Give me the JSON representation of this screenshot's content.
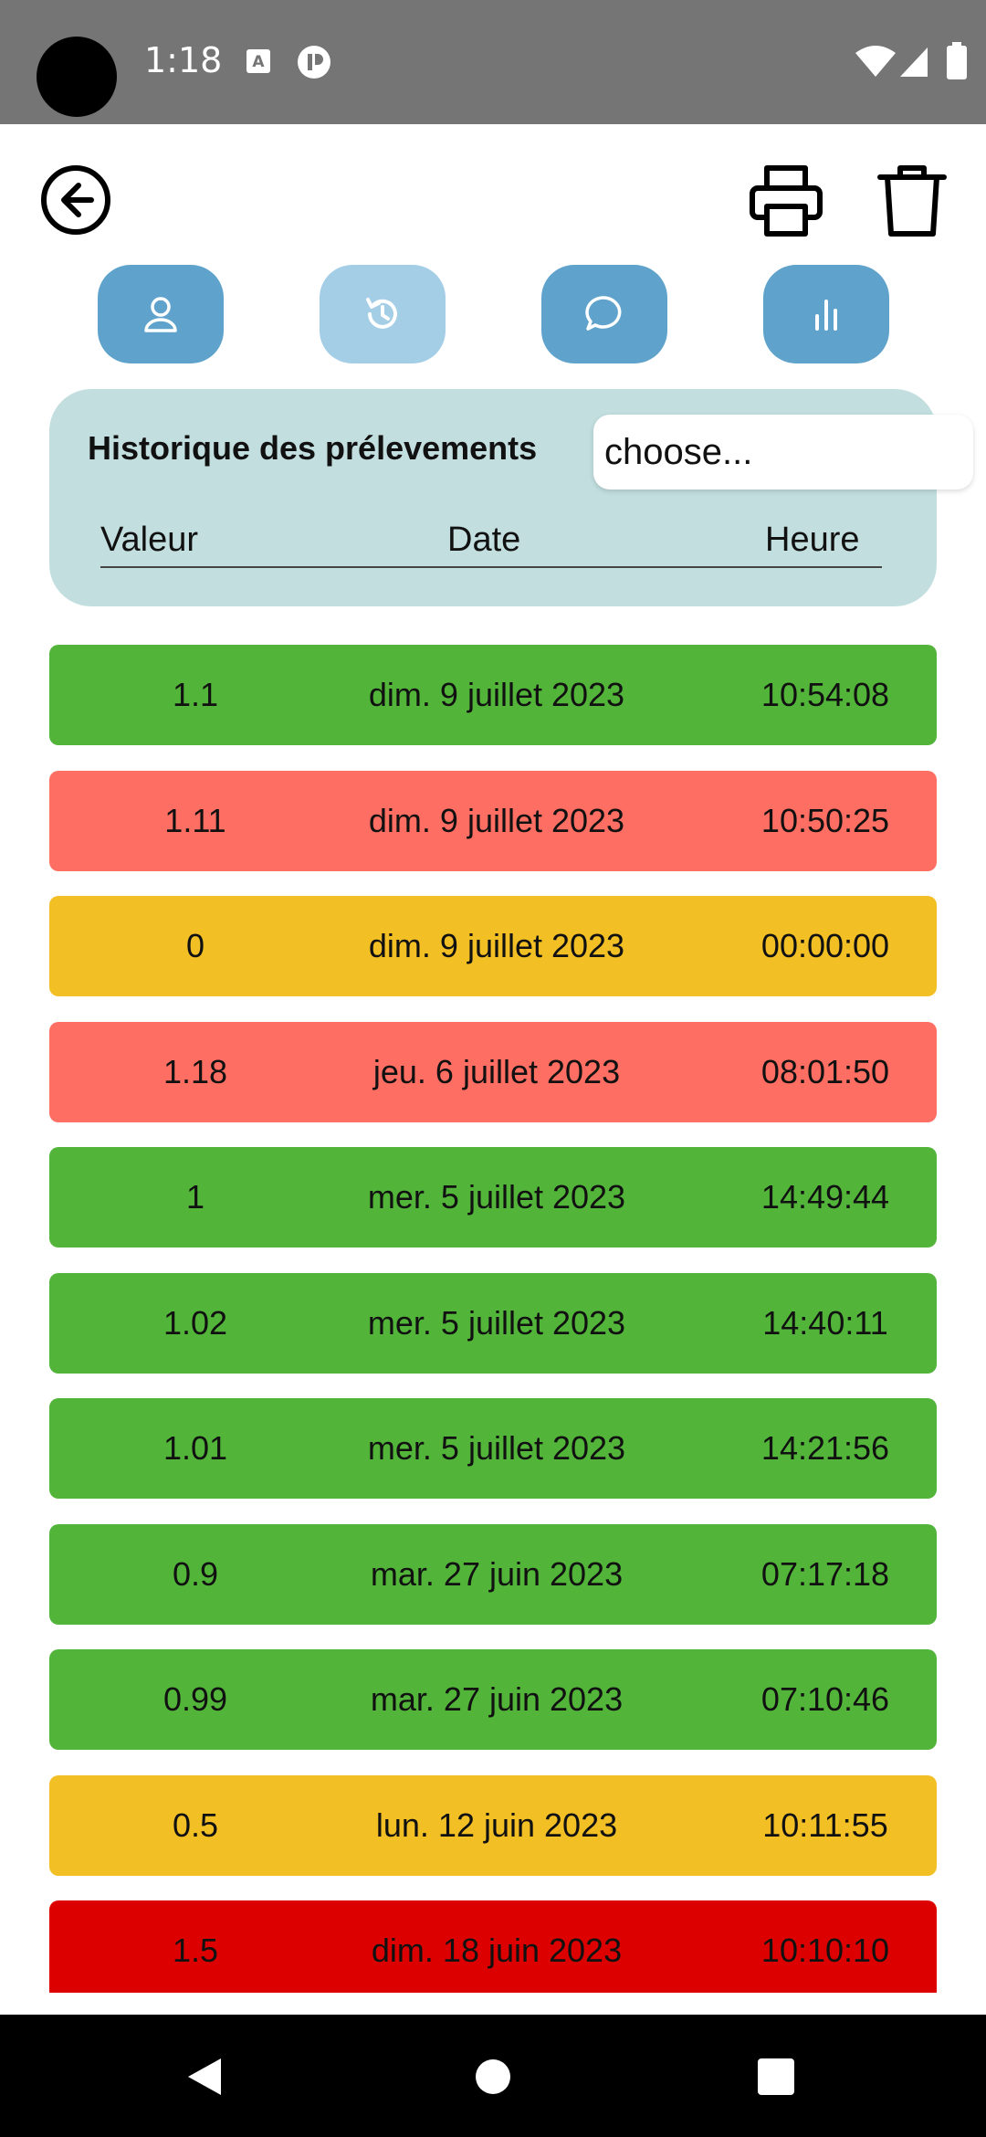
{
  "status_bar": {
    "time": "1:18"
  },
  "icons": {
    "back": "arrow-left-circle-icon",
    "print": "printer-icon",
    "trash": "trash-icon",
    "tabs": [
      "user-icon",
      "history-icon",
      "chat-icon",
      "bar-chart-icon"
    ]
  },
  "header": {
    "title": "Historique des prélevements",
    "select_value": "choose...",
    "columns": {
      "value": "Valeur",
      "date": "Date",
      "time": "Heure"
    }
  },
  "colors": {
    "green": "#52b53a",
    "salmon": "#fe6e62",
    "amber": "#f2bf25",
    "red": "#dc0000",
    "tab": "#5fa3cc",
    "tab_active": "#a4cde6",
    "card": "#c2dedf"
  },
  "rows": [
    {
      "value": "1.1",
      "date": "dim. 9 juillet 2023",
      "time": "10:54:08",
      "color": "#52b53a"
    },
    {
      "value": "1.11",
      "date": "dim. 9 juillet 2023",
      "time": "10:50:25",
      "color": "#fe6e62"
    },
    {
      "value": "0",
      "date": "dim. 9 juillet 2023",
      "time": "00:00:00",
      "color": "#f2bf25"
    },
    {
      "value": "1.18",
      "date": "jeu. 6 juillet 2023",
      "time": "08:01:50",
      "color": "#fe6e62"
    },
    {
      "value": "1",
      "date": "mer. 5 juillet 2023",
      "time": "14:49:44",
      "color": "#52b53a"
    },
    {
      "value": "1.02",
      "date": "mer. 5 juillet 2023",
      "time": "14:40:11",
      "color": "#52b53a"
    },
    {
      "value": "1.01",
      "date": "mer. 5 juillet 2023",
      "time": "14:21:56",
      "color": "#52b53a"
    },
    {
      "value": "0.9",
      "date": "mar. 27 juin 2023",
      "time": "07:17:18",
      "color": "#52b53a"
    },
    {
      "value": "0.99",
      "date": "mar. 27 juin 2023",
      "time": "07:10:46",
      "color": "#52b53a"
    },
    {
      "value": "0.5",
      "date": "lun. 12 juin 2023",
      "time": "10:11:55",
      "color": "#f2bf25"
    },
    {
      "value": "1.5",
      "date": "dim. 18 juin 2023",
      "time": "10:10:10",
      "color": "#dc0000"
    }
  ]
}
